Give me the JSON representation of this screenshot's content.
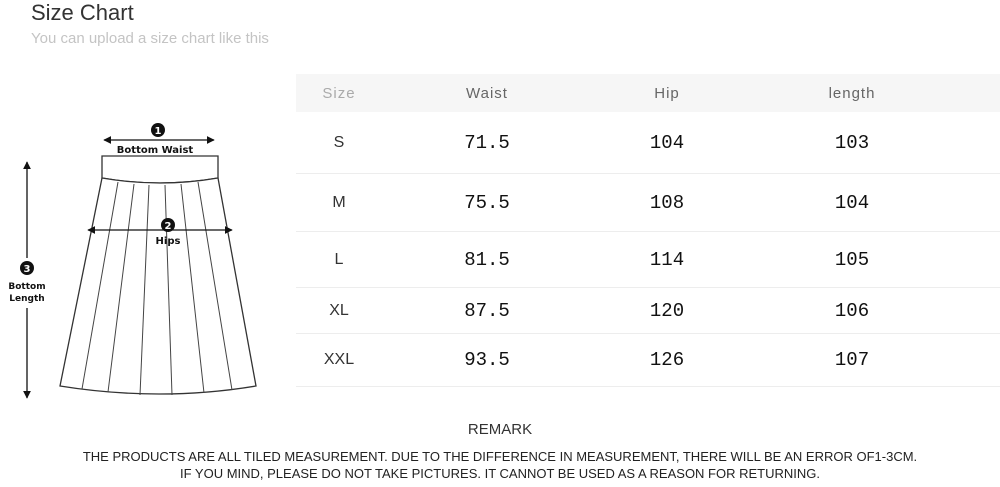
{
  "header": {
    "title": "Size Chart",
    "subtitle": "You can upload a size chart like this"
  },
  "diagram": {
    "labels": [
      {
        "number": "1",
        "text": "Bottom Waist"
      },
      {
        "number": "2",
        "text": "Hips"
      },
      {
        "number": "3",
        "text_line1": "Bottom",
        "text_line2": "Length"
      }
    ]
  },
  "table": {
    "columns": [
      "Size",
      "Waist",
      "Hip",
      "length"
    ],
    "rows": [
      {
        "size": "S",
        "waist": "71.5",
        "hip": "104",
        "length": "103"
      },
      {
        "size": "M",
        "waist": "75.5",
        "hip": "108",
        "length": "104"
      },
      {
        "size": "L",
        "waist": "81.5",
        "hip": "114",
        "length": "105"
      },
      {
        "size": "XL",
        "waist": "87.5",
        "hip": "120",
        "length": "106"
      },
      {
        "size": "XXL",
        "waist": "93.5",
        "hip": "126",
        "length": "107"
      }
    ]
  },
  "remark": {
    "title": "REMARK",
    "line1": "THE PRODUCTS ARE ALL TILED MEASUREMENT. DUE TO THE DIFFERENCE IN MEASUREMENT, THERE WILL BE AN ERROR OF1-3CM.",
    "line2": "IF YOU MIND, PLEASE DO NOT TAKE PICTURES. IT CANNOT BE USED AS A REASON FOR RETURNING."
  }
}
